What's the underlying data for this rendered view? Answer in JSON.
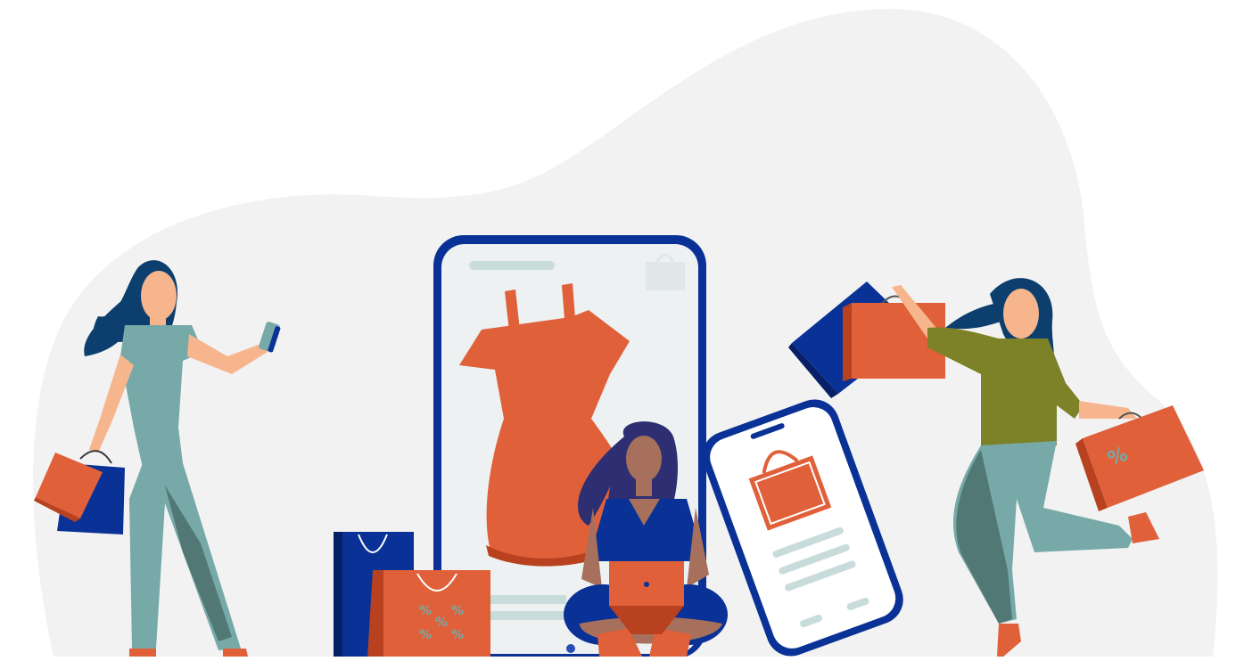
{
  "illustration": {
    "subject": "online shopping",
    "background_blob_color": "#f2f2f2",
    "colors": {
      "brand_blue": "#0a3296",
      "bag_orange": "#e0603a",
      "bag_orange_dark": "#b8421f",
      "teal": "#76a9a8",
      "teal_dark": "#527876",
      "olive": "#7d8128",
      "skin_light": "#f7b58d",
      "skin_dark": "#a7705c",
      "hair": "#0c3f6e",
      "hair_purple": "#2d2f72",
      "screen_bg": "#edf1f1",
      "screen_lines": "#c9dcdc"
    },
    "bag_marks": {
      "percent_sign": "%"
    },
    "icons": [
      "shopping-bag-icon",
      "dress-icon",
      "smartphone-icon",
      "laptop-icon"
    ]
  }
}
